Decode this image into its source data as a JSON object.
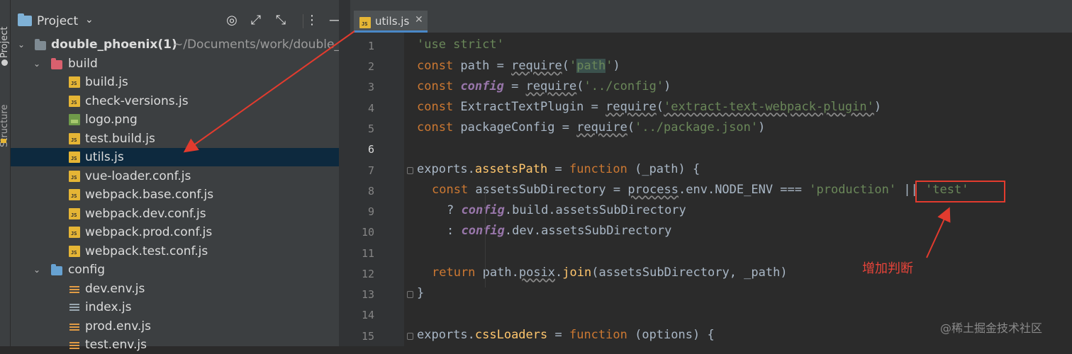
{
  "sidebar": {
    "project_tab": "Project",
    "structure_tab": "Structure"
  },
  "project_panel": {
    "title": "Project",
    "root": {
      "name": "double_phoenix(1)",
      "path": "~/Documents/work/double_"
    },
    "tree": [
      {
        "label": "build",
        "icon": "folder-red"
      },
      {
        "label": "build.js",
        "icon": "js"
      },
      {
        "label": "check-versions.js",
        "icon": "js"
      },
      {
        "label": "logo.png",
        "icon": "png"
      },
      {
        "label": "test.build.js",
        "icon": "js"
      },
      {
        "label": "utils.js",
        "icon": "js"
      },
      {
        "label": "vue-loader.conf.js",
        "icon": "js"
      },
      {
        "label": "webpack.base.conf.js",
        "icon": "js"
      },
      {
        "label": "webpack.dev.conf.js",
        "icon": "js"
      },
      {
        "label": "webpack.prod.conf.js",
        "icon": "js"
      },
      {
        "label": "webpack.test.conf.js",
        "icon": "js"
      },
      {
        "label": "config",
        "icon": "folder-blue"
      },
      {
        "label": "dev.env.js",
        "icon": "env"
      },
      {
        "label": "index.js",
        "icon": "index"
      },
      {
        "label": "prod.env.js",
        "icon": "env"
      },
      {
        "label": "test.env.js",
        "icon": "env"
      }
    ]
  },
  "editor": {
    "tab_label": "utils.js",
    "line_numbers": [
      "1",
      "2",
      "3",
      "4",
      "5",
      "6",
      "7",
      "8",
      "9",
      "10",
      "11",
      "12",
      "13",
      "14",
      "15"
    ],
    "code": {
      "l1_str": "'use strict'",
      "l2_kw": "const",
      "l2_a": " path = ",
      "l2_req": "require",
      "l2_b": "(",
      "l2_q1": "'",
      "l2_arg": "path",
      "l2_q2": "'",
      "l2_c": ")",
      "l3_kw": "const",
      "l3_var": "config",
      "l3_a": " = ",
      "l3_req": "require",
      "l3_b": "(",
      "l3_str": "'../config'",
      "l3_c": ")",
      "l4_kw": "const",
      "l4_a": " ExtractTextPlugin = ",
      "l4_req": "require",
      "l4_b": "(",
      "l4_str": "'extract-text-webpack-plugin'",
      "l4_c": ")",
      "l5_kw": "const",
      "l5_a": " packageConfig = ",
      "l5_req": "require",
      "l5_b": "(",
      "l5_str": "'../package.json'",
      "l5_c": ")",
      "l7_a": "exports.",
      "l7_fn": "assetsPath",
      "l7_b": " = ",
      "l7_kw": "function",
      "l7_c": " (_path) {",
      "l8_kw": "const",
      "l8_a": " assetsSubDirectory = ",
      "l8_proc": "process",
      "l8_b": ".env.NODE_ENV === ",
      "l8_str": "'production'",
      "l8_c": " || ",
      "l8_str2": "'test'",
      "l9_a": "? ",
      "l9_var": "config",
      "l9_b": ".build.assetsSubDirectory",
      "l10_a": ": ",
      "l10_var": "config",
      "l10_b": ".dev.assetsSubDirectory",
      "l12_kw": "return",
      "l12_a": " path.",
      "l12_posix": "posix",
      "l12_b": ".",
      "l12_fn": "join",
      "l12_c": "(assetsSubDirectory, _path)",
      "l13_a": "}",
      "l15_a": "exports.",
      "l15_fn": "cssLoaders",
      "l15_b": " = ",
      "l15_kw": "function",
      "l15_c": " (options) {"
    }
  },
  "annotation": {
    "label": "增加判断",
    "color": "#e8443a"
  },
  "watermark": "@稀土掘金技术社区",
  "colors": {
    "keyword": "#cc7832",
    "string": "#6a8759",
    "selection": "#0d293e",
    "tab_underline": "#4a88c7"
  }
}
